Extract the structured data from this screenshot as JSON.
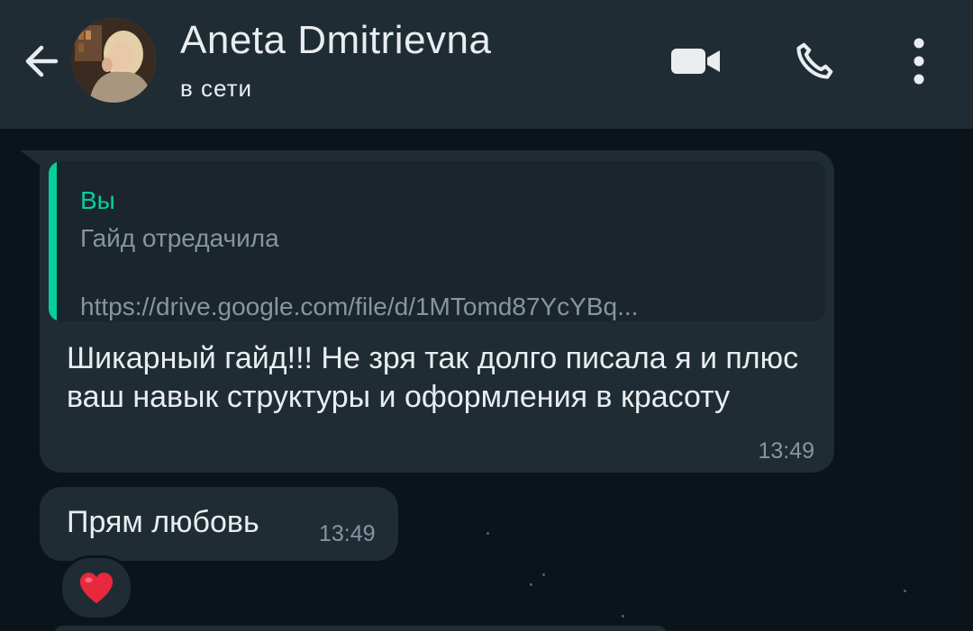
{
  "header": {
    "contact_name": "Aneta Dmitrievna",
    "status": "в сети",
    "icons": {
      "back": "arrow-left-icon",
      "video": "video-camera-icon",
      "call": "phone-icon",
      "menu": "more-vertical-icon"
    }
  },
  "messages": [
    {
      "quote": {
        "author": "Вы",
        "text": "Гайд отредачила",
        "link": "https://drive.google.com/file/d/1MTomd87YcYBq..."
      },
      "text": "Шикарный гайд!!! Не зря так долго писала я и плюс ваш навык структуры и оформления в красоту",
      "time": "13:49"
    },
    {
      "text": "Прям любовь",
      "time": "13:49",
      "reaction": "heart-icon"
    }
  ],
  "colors": {
    "header_bg": "#1f2c34",
    "chat_bg": "#0b141a",
    "bubble_bg": "#1f2c34",
    "accent": "#06cf9c",
    "text_primary": "#e9edef",
    "text_secondary": "#8696a0",
    "heart": "#e8283c"
  }
}
